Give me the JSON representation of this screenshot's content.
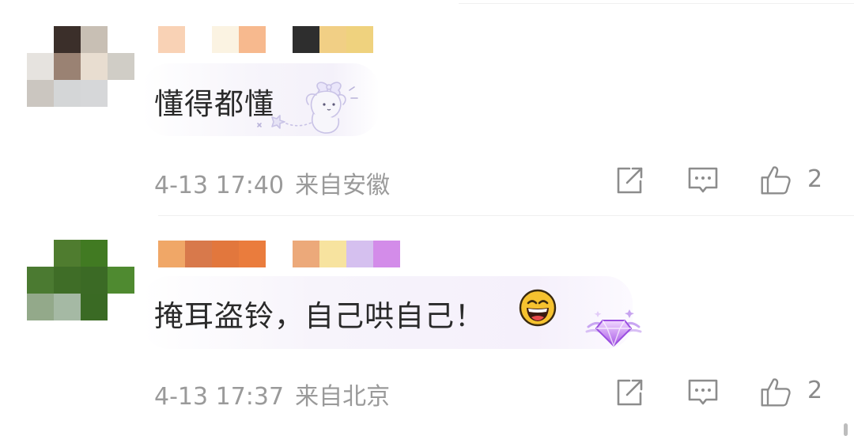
{
  "comments": [
    {
      "text": "懂得都懂",
      "time": "4-13 17:40",
      "location": "来自安徽",
      "likes": "2",
      "avatar_colors": [
        [
          "#ffffff",
          "#3b2f2a",
          "#c8bfb4",
          "#ffffff"
        ],
        [
          "#e6e3df",
          "#9a8273",
          "#e8ddd0",
          "#d0cdc6"
        ],
        [
          "#cbc6c0",
          "#d4d6d7",
          "#d6d7d9",
          "#ffffff"
        ]
      ],
      "username_colors": [
        "#f9d2b5",
        "#fbf3e2",
        "#f7b98e",
        "#2e2e2e",
        "#f1cf85",
        "#efd27e"
      ],
      "decoration": "bunny-sticker"
    },
    {
      "text": "掩耳盗铃，自己哄自己！",
      "time": "4-13 17:37",
      "location": "来自北京",
      "likes": "2",
      "avatar_colors": [
        [
          "#ffffff",
          "#4f7c2f",
          "#417a22",
          "#ffffff"
        ],
        [
          "#4b7a31",
          "#3f6d27",
          "#3b6a25",
          "#4f8a30"
        ],
        [
          "#93a98a",
          "#a5b9a4",
          "#3a6a24",
          "#ffffff"
        ]
      ],
      "username_colors": [
        "#f0a767",
        "#d8794b",
        "#e2773d",
        "#ea7c3d",
        "#eca97a",
        "#f7e39f",
        "#d5c0ef",
        "#d38ce9"
      ],
      "decoration": "purple-gem-badge",
      "emoji": "laughing-face"
    }
  ],
  "icons": {
    "share": "share-icon",
    "reply": "comment-icon",
    "like": "thumbs-up-icon"
  }
}
